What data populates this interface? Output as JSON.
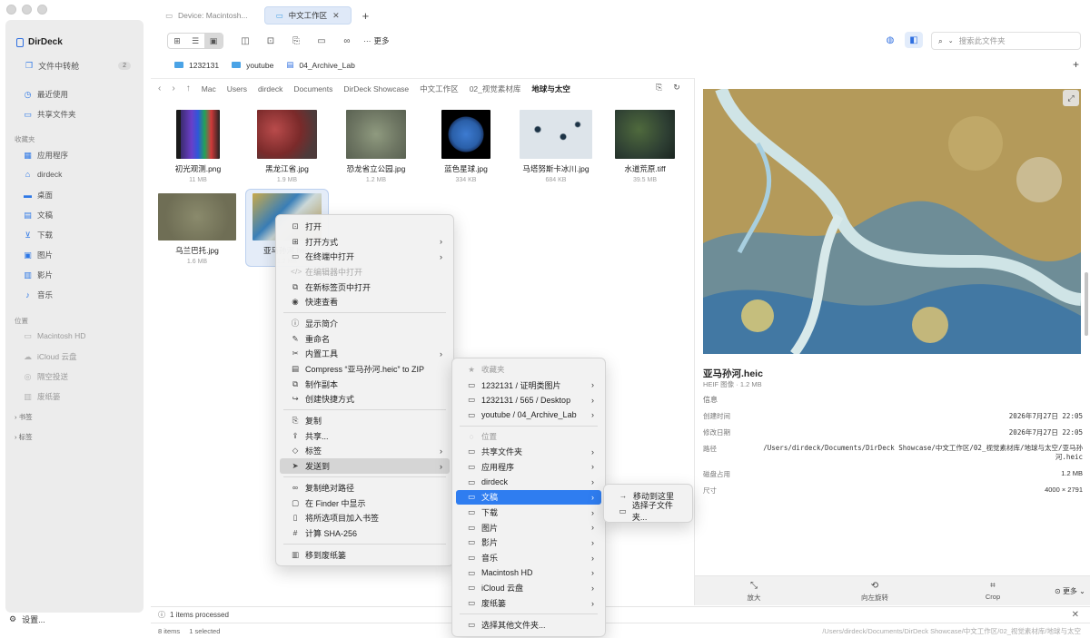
{
  "app": {
    "name": "DirDeck"
  },
  "sidebar": {
    "transfer": {
      "label": "文件中转舱",
      "count": "2"
    },
    "top_items": [
      {
        "label": "最近使用",
        "icon": "clock-icon"
      },
      {
        "label": "共享文件夹",
        "icon": "shared-folder-icon"
      }
    ],
    "favorites_header": "收藏夹",
    "favorites": [
      {
        "label": "应用程序",
        "icon": "apps-icon"
      },
      {
        "label": "dirdeck",
        "icon": "home-icon"
      },
      {
        "label": "桌面",
        "icon": "desktop-icon"
      },
      {
        "label": "文稿",
        "icon": "document-icon"
      },
      {
        "label": "下载",
        "icon": "download-icon"
      },
      {
        "label": "图片",
        "icon": "photo-icon"
      },
      {
        "label": "影片",
        "icon": "film-icon"
      },
      {
        "label": "音乐",
        "icon": "music-icon"
      }
    ],
    "locations_header": "位置",
    "locations": [
      {
        "label": "Macintosh HD",
        "icon": "disk-icon"
      },
      {
        "label": "iCloud 云盘",
        "icon": "cloud-icon"
      },
      {
        "label": "隔空投送",
        "icon": "airdrop-icon"
      },
      {
        "label": "废纸篓",
        "icon": "trash-icon"
      }
    ],
    "bookmarks_header": "书签",
    "tags_header": "标签",
    "settings": "设置..."
  },
  "tabs": [
    {
      "label": "Device: Macintosh..."
    },
    {
      "label": "中文工作区"
    }
  ],
  "toolbar": {
    "more": "更多"
  },
  "search": {
    "placeholder": "搜索此文件夹"
  },
  "bookmarks": [
    "1232131",
    "youtube",
    "04_Archive_Lab"
  ],
  "path": [
    "Mac",
    "Users",
    "dirdeck",
    "Documents",
    "DirDeck Showcase",
    "中文工作区",
    "02_视觉素材库",
    "地球与太空"
  ],
  "files": [
    {
      "name": "初光观测.png",
      "size": "11 MB"
    },
    {
      "name": "黑龙江省.jpg",
      "size": "1.9 MB"
    },
    {
      "name": "恐龙省立公园.jpg",
      "size": "1.2 MB"
    },
    {
      "name": "蓝色星球.jpg",
      "size": "334 KB"
    },
    {
      "name": "马塔努斯卡冰川.jpg",
      "size": "684 KB"
    },
    {
      "name": "水道荒原.tiff",
      "size": "39.5 MB"
    },
    {
      "name": "乌兰巴托.jpg",
      "size": "1.6 MB"
    },
    {
      "name": "亚马孙河.heic",
      "size": "1.2 MB"
    }
  ],
  "context_menu": [
    {
      "label": "打开",
      "icon": "open-icon"
    },
    {
      "label": "打开方式",
      "icon": "open-with-icon",
      "sub": true
    },
    {
      "label": "在终端中打开",
      "icon": "terminal-icon",
      "sub": true
    },
    {
      "label": "在编辑器中打开",
      "icon": "code-icon",
      "disabled": true
    },
    {
      "label": "在新标签页中打开",
      "icon": "new-tab-icon"
    },
    {
      "label": "快速查看",
      "icon": "eye-icon"
    },
    {
      "sep": true
    },
    {
      "label": "显示简介",
      "icon": "info-icon"
    },
    {
      "label": "重命名",
      "icon": "pencil-icon"
    },
    {
      "label": "内置工具",
      "icon": "tools-icon",
      "sub": true
    },
    {
      "label": "Compress “亚马孙河.heic” to ZIP",
      "icon": "zip-icon"
    },
    {
      "label": "制作副本",
      "icon": "duplicate-icon"
    },
    {
      "label": "创建快捷方式",
      "icon": "shortcut-icon"
    },
    {
      "sep": true
    },
    {
      "label": "复制",
      "icon": "copy-icon"
    },
    {
      "label": "共享...",
      "icon": "share-icon"
    },
    {
      "label": "标签",
      "icon": "tag-icon",
      "sub": true
    },
    {
      "label": "发送到",
      "icon": "send-icon",
      "sub": true,
      "highlight": true
    },
    {
      "sep": true
    },
    {
      "label": "复制绝对路径",
      "icon": "link-icon"
    },
    {
      "label": "在 Finder 中显示",
      "icon": "finder-icon"
    },
    {
      "label": "将所选项目加入书签",
      "icon": "bookmark-icon"
    },
    {
      "label": "计算 SHA-256",
      "icon": "hash-icon"
    },
    {
      "sep": true
    },
    {
      "label": "移到废纸篓",
      "icon": "trash-icon"
    }
  ],
  "send_menu": [
    {
      "label": "收藏夹",
      "icon": "star-icon",
      "head": true
    },
    {
      "label": "1232131 / 证明类图片",
      "icon": "folder-icon",
      "sub": true
    },
    {
      "label": "1232131 / 565 / Desktop",
      "icon": "folder-icon",
      "sub": true
    },
    {
      "label": "youtube / 04_Archive_Lab",
      "icon": "folder-icon",
      "sub": true
    },
    {
      "sep": true
    },
    {
      "label": "位置",
      "icon": "location-icon",
      "head": true
    },
    {
      "label": "共享文件夹",
      "icon": "folder-icon",
      "sub": true
    },
    {
      "label": "应用程序",
      "icon": "folder-icon",
      "sub": true
    },
    {
      "label": "dirdeck",
      "icon": "folder-icon",
      "sub": true
    },
    {
      "label": "文稿",
      "icon": "folder-icon",
      "sub": true,
      "active": true
    },
    {
      "label": "下载",
      "icon": "folder-icon",
      "sub": true
    },
    {
      "label": "图片",
      "icon": "folder-icon",
      "sub": true
    },
    {
      "label": "影片",
      "icon": "folder-icon",
      "sub": true
    },
    {
      "label": "音乐",
      "icon": "folder-icon",
      "sub": true
    },
    {
      "label": "Macintosh HD",
      "icon": "folder-icon",
      "sub": true
    },
    {
      "label": "iCloud 云盘",
      "icon": "folder-icon",
      "sub": true
    },
    {
      "label": "废纸篓",
      "icon": "folder-icon",
      "sub": true
    },
    {
      "sep": true
    },
    {
      "label": "选择其他文件夹...",
      "icon": "folder-choose-icon"
    }
  ],
  "move_menu": [
    {
      "label": "移动到这里",
      "icon": "arrow-right-icon"
    },
    {
      "label": "选择子文件夹...",
      "icon": "subfolder-icon"
    }
  ],
  "preview": {
    "name": "亚马孙河.heic",
    "type": "HEIF 图像 · 1.2 MB",
    "info_header": "信息",
    "rows": [
      {
        "k": "创建时间",
        "v": "2026年7月27日 22:05"
      },
      {
        "k": "修改日期",
        "v": "2026年7月27日 22:05"
      },
      {
        "k": "路径",
        "v": "/Users/dirdeck/Documents/DirDeck Showcase/中文工作区/02_视觉素材库/地球与太空/亚马孙河.heic"
      },
      {
        "k": "磁盘占用",
        "v": "1.2 MB"
      },
      {
        "k": "尺寸",
        "v": "4000 × 2791"
      }
    ],
    "actions": [
      {
        "label": "放大"
      },
      {
        "label": "向左旋转"
      },
      {
        "label": "Crop"
      }
    ],
    "more": "更多"
  },
  "status": {
    "processed": "1 items processed",
    "count": "8 items",
    "selected": "1 selected",
    "path": "/Users/dirdeck/Documents/DirDeck Showcase/中文工作区/02_视觉素材库/地球与太空"
  },
  "colors": {
    "accent": "#2f7df0",
    "sidebar_bg": "#ececec"
  }
}
